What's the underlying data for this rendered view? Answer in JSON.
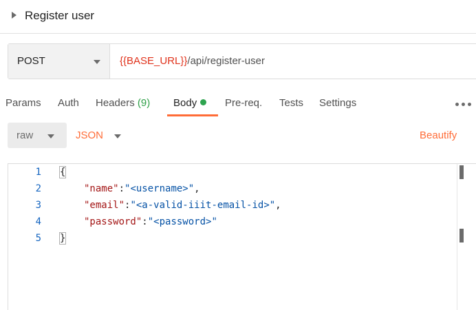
{
  "header": {
    "title": "Register user"
  },
  "request": {
    "method": "POST",
    "url_variable": "{{BASE_URL}}",
    "url_path": "/api/register-user"
  },
  "tabs": [
    {
      "label": "Params"
    },
    {
      "label": "Auth"
    },
    {
      "label": "Headers",
      "count": "(9)"
    },
    {
      "label": "Body",
      "active": true
    },
    {
      "label": "Pre-req."
    },
    {
      "label": "Tests"
    },
    {
      "label": "Settings"
    }
  ],
  "body_options": {
    "mode": "raw",
    "language": "JSON",
    "beautify_label": "Beautify"
  },
  "editor": {
    "line_numbers": [
      "1",
      "2",
      "3",
      "4",
      "5"
    ],
    "lines": {
      "open": "{",
      "name_key": "\"name\"",
      "name_value": "\"<username>\"",
      "email_key": "\"email\"",
      "email_value": "\"<a-valid-iiit-email-id>\"",
      "password_key": "\"password\"",
      "password_value": "\"<password>\"",
      "close": "}"
    }
  },
  "colors": {
    "accent": "#ff6c37",
    "url_variable": "#e0321b",
    "active_dot": "#2ea44f",
    "line_number": "#1565c0",
    "json_key": "#a31515",
    "json_value": "#0451a5"
  }
}
